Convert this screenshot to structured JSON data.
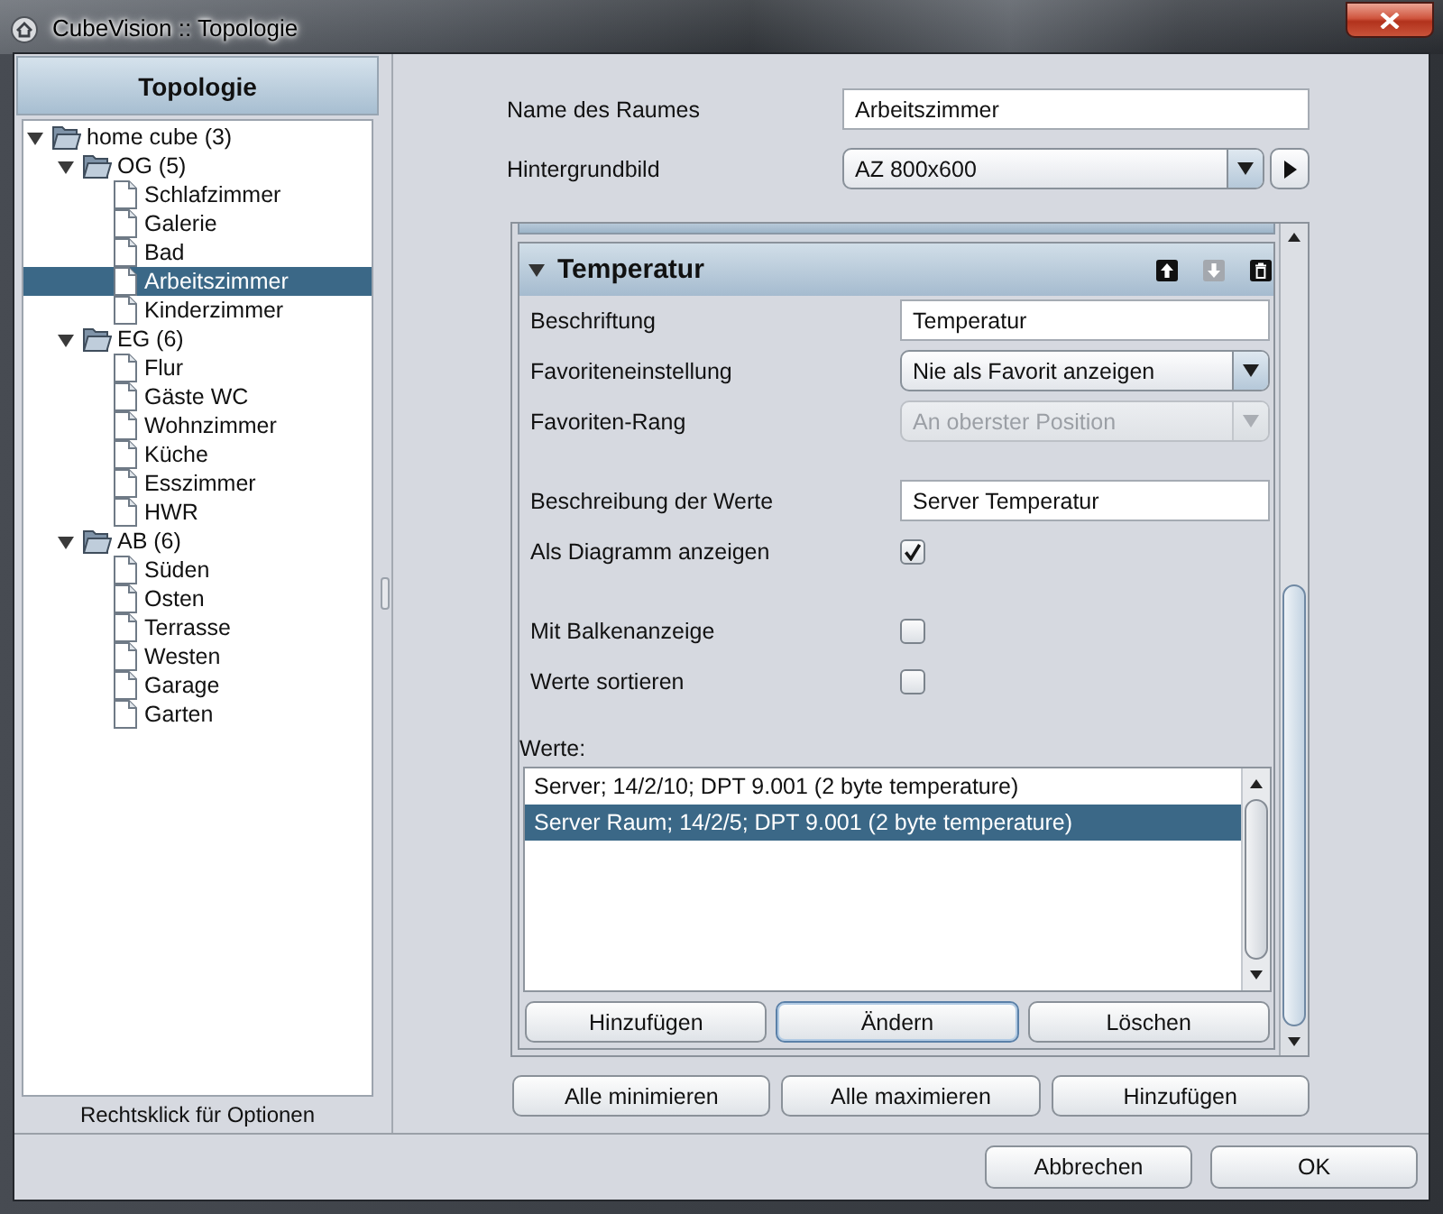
{
  "window": {
    "title": "CubeVision :: Topologie"
  },
  "sidebar": {
    "title": "Topologie",
    "tree": [
      {
        "label": "home cube (3)",
        "kind": "folder",
        "expanded": true,
        "selected": false,
        "children": [
          {
            "label": "OG (5)",
            "kind": "folder",
            "expanded": true,
            "selected": false,
            "children": [
              {
                "label": "Schlafzimmer",
                "kind": "room",
                "selected": false
              },
              {
                "label": "Galerie",
                "kind": "room",
                "selected": false
              },
              {
                "label": "Bad",
                "kind": "room",
                "selected": false
              },
              {
                "label": "Arbeitszimmer",
                "kind": "room",
                "selected": true
              },
              {
                "label": "Kinderzimmer",
                "kind": "room",
                "selected": false
              }
            ]
          },
          {
            "label": "EG (6)",
            "kind": "folder",
            "expanded": true,
            "selected": false,
            "children": [
              {
                "label": "Flur",
                "kind": "room",
                "selected": false
              },
              {
                "label": "Gäste WC",
                "kind": "room",
                "selected": false
              },
              {
                "label": "Wohnzimmer",
                "kind": "room",
                "selected": false
              },
              {
                "label": "Küche",
                "kind": "room",
                "selected": false
              },
              {
                "label": "Esszimmer",
                "kind": "room",
                "selected": false
              },
              {
                "label": "HWR",
                "kind": "room",
                "selected": false
              }
            ]
          },
          {
            "label": "AB (6)",
            "kind": "folder",
            "expanded": true,
            "selected": false,
            "children": [
              {
                "label": "Süden",
                "kind": "room",
                "selected": false
              },
              {
                "label": "Osten",
                "kind": "room",
                "selected": false
              },
              {
                "label": "Terrasse",
                "kind": "room",
                "selected": false
              },
              {
                "label": "Westen",
                "kind": "room",
                "selected": false
              },
              {
                "label": "Garage",
                "kind": "room",
                "selected": false
              },
              {
                "label": "Garten",
                "kind": "room",
                "selected": false
              }
            ]
          }
        ]
      }
    ],
    "hint": "Rechtsklick für Optionen"
  },
  "room": {
    "fields": [
      {
        "kind": "text",
        "label": "Name des Raumes",
        "value": "Arbeitszimmer"
      },
      {
        "kind": "select_with_button",
        "label": "Hintergrundbild",
        "value": "AZ 800x600"
      }
    ]
  },
  "section": {
    "title": "Temperatur",
    "expanded": true,
    "toolbar": [
      {
        "kind": "up",
        "disabled": false
      },
      {
        "kind": "down",
        "disabled": true
      },
      {
        "kind": "delete",
        "disabled": false
      }
    ],
    "groups": [
      [
        {
          "kind": "text",
          "label": "Beschriftung",
          "value": "Temperatur"
        },
        {
          "kind": "select",
          "label": "Favoriteneinstellung",
          "value": "Nie als Favorit anzeigen",
          "disabled": false
        },
        {
          "kind": "select",
          "label": "Favoriten-Rang",
          "value": "An oberster Position",
          "disabled": true
        }
      ],
      [
        {
          "kind": "text",
          "label": "Beschreibung der Werte",
          "value": "Server Temperatur"
        },
        {
          "kind": "checkbox",
          "label": "Als Diagramm anzeigen",
          "checked": true
        }
      ],
      [
        {
          "kind": "checkbox",
          "label": "Mit Balkenanzeige",
          "checked": false
        },
        {
          "kind": "checkbox",
          "label": "Werte sortieren",
          "checked": false
        }
      ]
    ],
    "values": {
      "label": "Werte:",
      "items": [
        {
          "text": "Server; 14/2/10; DPT 9.001 (2 byte temperature)",
          "selected": false
        },
        {
          "text": "Server Raum; 14/2/5; DPT 9.001 (2 byte temperature)",
          "selected": true
        }
      ],
      "buttons": [
        {
          "label": "Hinzufügen",
          "focused": false
        },
        {
          "label": "Ändern",
          "focused": true
        },
        {
          "label": "Löschen",
          "focused": false
        }
      ]
    }
  },
  "panel_buttons": [
    "Alle minimieren",
    "Alle maximieren",
    "Hinzufügen"
  ],
  "dialog_buttons": [
    "Abbrechen",
    "OK"
  ]
}
